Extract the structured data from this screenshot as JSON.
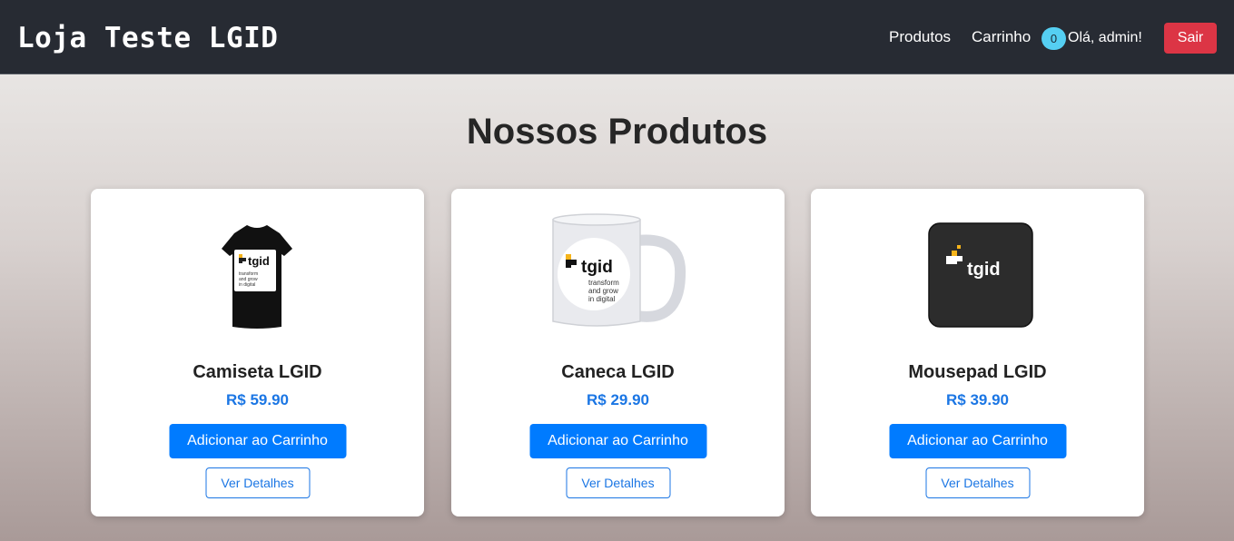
{
  "header": {
    "brand": "Loja Teste LGID",
    "nav_produtos": "Produtos",
    "nav_carrinho": "Carrinho",
    "cart_count": "0",
    "greeting": "Olá, admin!",
    "logout_label": "Sair"
  },
  "main": {
    "title": "Nossos Produtos",
    "products": [
      {
        "name": "Camiseta LGID",
        "price": "R$ 59.90",
        "add_label": "Adicionar ao Carrinho",
        "details_label": "Ver Detalhes",
        "image_icon": "tshirt-image",
        "logo_text": "tgid",
        "tagline": "transform and grow in digital"
      },
      {
        "name": "Caneca LGID",
        "price": "R$ 29.90",
        "add_label": "Adicionar ao Carrinho",
        "details_label": "Ver Detalhes",
        "image_icon": "mug-image",
        "logo_text": "tgid",
        "tagline": "transform and grow in digital"
      },
      {
        "name": "Mousepad LGID",
        "price": "R$ 39.90",
        "add_label": "Adicionar ao Carrinho",
        "details_label": "Ver Detalhes",
        "image_icon": "mousepad-image",
        "logo_text": "tgid"
      }
    ]
  },
  "colors": {
    "navbar_bg": "#272b33",
    "primary": "#007bff",
    "danger": "#dc3545",
    "badge": "#55cff2",
    "logo_accent": "#f6b41a"
  }
}
